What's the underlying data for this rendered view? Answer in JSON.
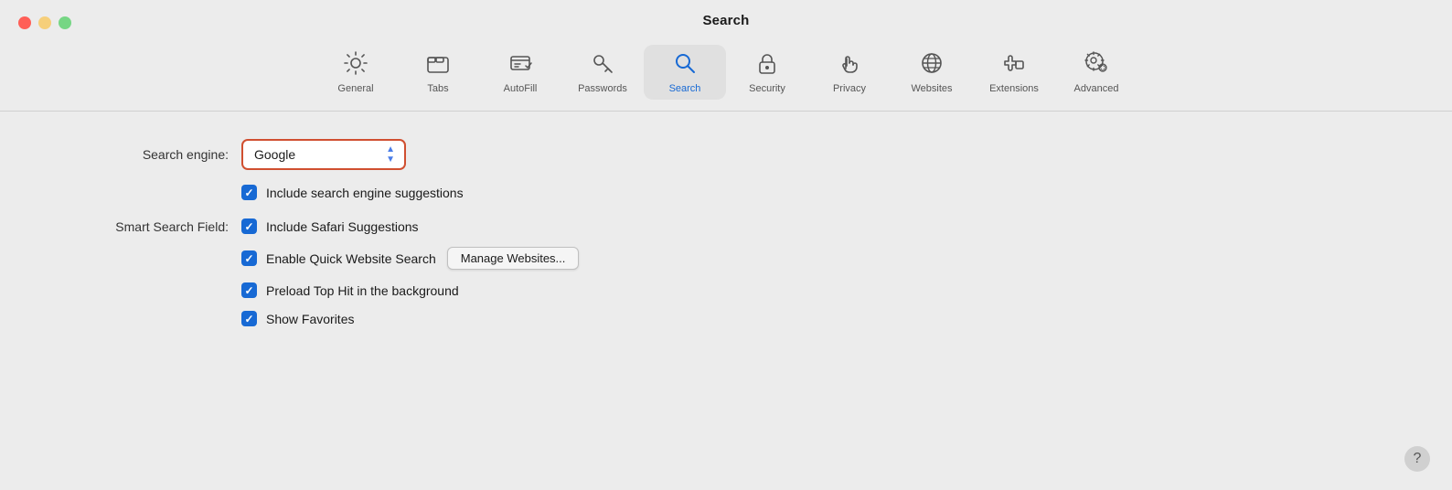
{
  "window": {
    "title": "Search",
    "controls": {
      "close_label": "",
      "minimize_label": "",
      "maximize_label": ""
    }
  },
  "toolbar": {
    "tabs": [
      {
        "id": "general",
        "label": "General",
        "icon": "gear"
      },
      {
        "id": "tabs",
        "label": "Tabs",
        "icon": "tabs"
      },
      {
        "id": "autofill",
        "label": "AutoFill",
        "icon": "autofill"
      },
      {
        "id": "passwords",
        "label": "Passwords",
        "icon": "key"
      },
      {
        "id": "search",
        "label": "Search",
        "icon": "search",
        "active": true
      },
      {
        "id": "security",
        "label": "Security",
        "icon": "lock"
      },
      {
        "id": "privacy",
        "label": "Privacy",
        "icon": "hand"
      },
      {
        "id": "websites",
        "label": "Websites",
        "icon": "globe"
      },
      {
        "id": "extensions",
        "label": "Extensions",
        "icon": "puzzle"
      },
      {
        "id": "advanced",
        "label": "Advanced",
        "icon": "gear-advanced"
      }
    ]
  },
  "main": {
    "search_engine_label": "Search engine:",
    "search_engine_value": "Google",
    "include_suggestions_label": "Include search engine suggestions",
    "include_suggestions_checked": true,
    "smart_search_label": "Smart Search Field:",
    "safari_suggestions_label": "Include Safari Suggestions",
    "safari_suggestions_checked": true,
    "quick_website_label": "Enable Quick Website Search",
    "quick_website_checked": true,
    "manage_websites_label": "Manage Websites...",
    "preload_label": "Preload Top Hit in the background",
    "preload_checked": true,
    "show_favorites_label": "Show Favorites",
    "show_favorites_checked": true
  },
  "help_button_label": "?"
}
